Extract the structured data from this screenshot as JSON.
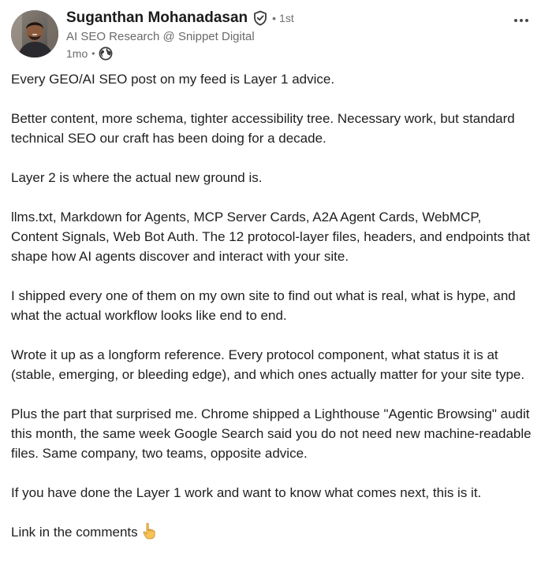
{
  "author": {
    "name": "Suganthan Mohanadasan",
    "degree": "1st",
    "headline": "AI SEO Research @ Snippet Digital",
    "time": "1mo",
    "visibility_icon": "globe-icon",
    "verified_icon": "verified-shield-icon",
    "more_icon": "more-horizontal-icon"
  },
  "post": {
    "paragraphs": [
      "Every GEO/AI SEO post on my feed is Layer 1 advice.",
      "Better content, more schema, tighter accessibility tree. Necessary work, but standard technical SEO our craft has been doing for a decade.",
      "Layer 2 is where the actual new ground is.",
      "llms.txt, Markdown for Agents, MCP Server Cards, A2A Agent Cards, WebMCP, Content Signals, Web Bot Auth. The 12 protocol-layer files, headers, and endpoints that shape how AI agents discover and interact with your site.",
      "I shipped every one of them on my own site to find out what is real, what is hype, and what the actual workflow looks like end to end.",
      "Wrote it up as a longform reference. Every protocol component, what status it is at (stable, emerging, or bleeding edge), and which ones actually matter for your site type.",
      "Plus the part that surprised me. Chrome shipped a Lighthouse \"Agentic Browsing\" audit this month, the same week Google Search said you do not need new machine-readable files. Same company, two teams, opposite advice.",
      "If you have done the Layer 1 work and want to know what comes next, this is it.",
      "Link in the comments"
    ],
    "closing_emoji_icon": "pointing-down-hand-icon"
  },
  "colors": {
    "text_primary": "#1f1f1f",
    "text_secondary": "#6a6a6a",
    "background": "#ffffff",
    "emoji_hand": "#f6c35a"
  }
}
